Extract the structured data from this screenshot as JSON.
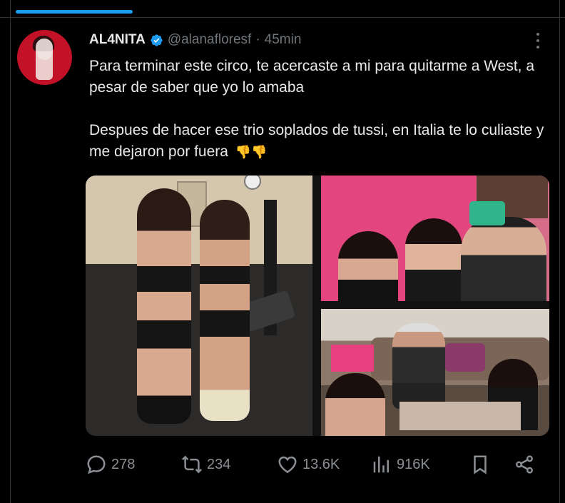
{
  "author": {
    "display_name": "AL4NITA",
    "handle": "@alanafloresf",
    "separator": "·",
    "time": "45min"
  },
  "tweet": {
    "paragraph_1": "Para terminar este circo, te acercaste a mi para quitarme a West, a pesar de saber que yo lo amaba",
    "paragraph_2": "Despues de hacer ese trio soplados de tussi, en Italia te lo culiaste y me dejaron por fuera",
    "emoji": "👎👎"
  },
  "actions": {
    "replies": "278",
    "reposts": "234",
    "likes": "13.6K",
    "views": "916K"
  },
  "icons": [
    "verified-icon",
    "more-icon",
    "reply-icon",
    "repost-icon",
    "like-icon",
    "views-icon",
    "bookmark-icon",
    "share-icon"
  ],
  "colors": {
    "background": "#000000",
    "text": "#e7e9ea",
    "muted": "#71767b",
    "accent": "#1d9bf0"
  }
}
